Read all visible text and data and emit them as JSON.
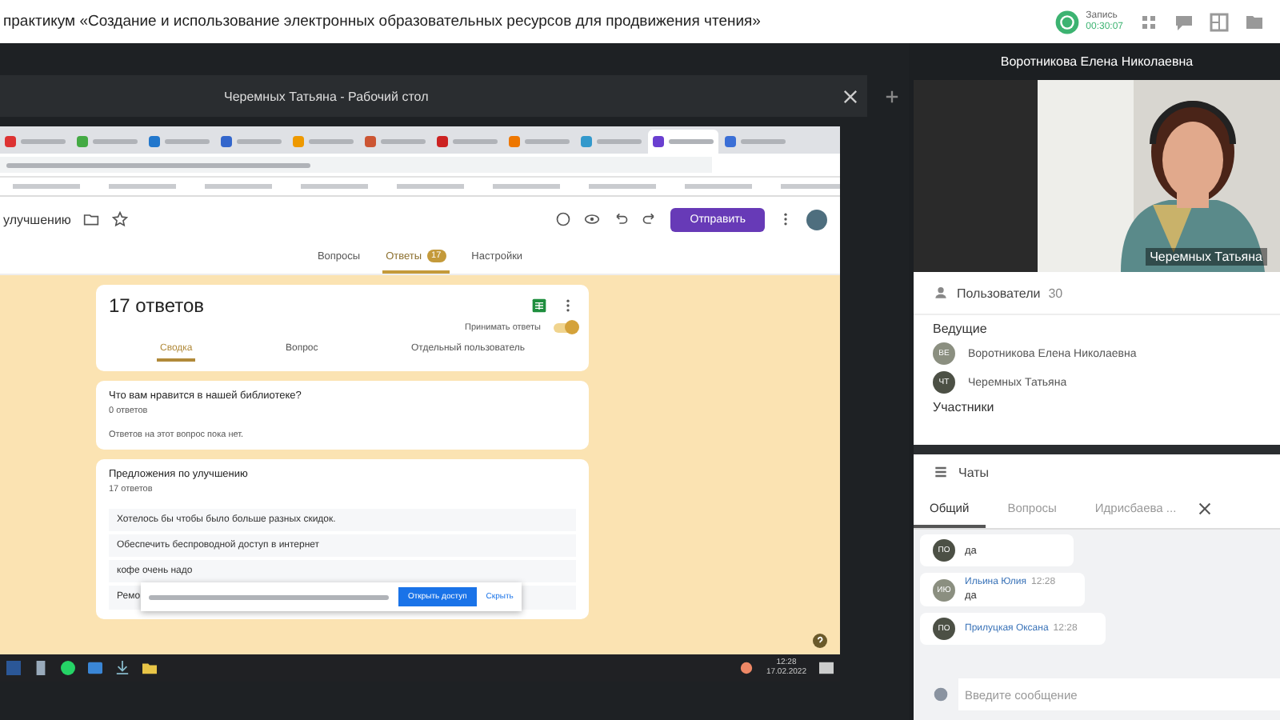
{
  "top_bar": {
    "title": "практикум «Создание и использование электронных образовательных ресурсов для продвижения чтения»",
    "record_label": "Запись",
    "record_time": "00:30:07",
    "recording": true
  },
  "shared_screen": {
    "window_title": "Черемных Татьяна - Рабочий стол",
    "browser": {
      "tabs": [
        {
          "selected": false
        },
        {
          "selected": false
        },
        {
          "selected": false
        },
        {
          "selected": false
        },
        {
          "selected": false
        },
        {
          "selected": false
        },
        {
          "selected": false
        },
        {
          "selected": false
        },
        {
          "selected": false
        },
        {
          "selected": true
        },
        {
          "selected": false
        }
      ],
      "form_title": "улучшению",
      "send_button": "Отправить",
      "form_tabs": [
        {
          "label": "Вопросы",
          "selected": false
        },
        {
          "label": "Ответы",
          "selected": true,
          "badge": "17"
        },
        {
          "label": "Настройки",
          "selected": false
        }
      ],
      "summary": {
        "title": "17 ответов",
        "accepting_label": "Принимать ответы",
        "accepting": true,
        "tabs": [
          {
            "label": "Сводка",
            "selected": true
          },
          {
            "label": "Вопрос",
            "selected": false
          },
          {
            "label": "Отдельный пользователь",
            "selected": false
          }
        ]
      },
      "questions": [
        {
          "title": "Что вам нравится в нашей библиотеке?",
          "count": "0 ответов",
          "empty_text": "Ответов на этот вопрос пока нет."
        },
        {
          "title": "Предложения по улучшению",
          "count": "17 ответов",
          "answers": [
            "Хотелось бы чтобы было больше разных скидок.",
            "Обеспечить беспроводной доступ в интернет",
            "кофе очень надо",
            "Ремо"
          ]
        }
      ],
      "snackbar": {
        "button": "Открыть доступ",
        "dismiss": "Скрыть"
      }
    },
    "taskbar": {
      "time": "12:28",
      "date": "17.02.2022"
    }
  },
  "video": {
    "header_name": "Воротникова Елена Николаевна",
    "overlay_name": "Черемных Татьяна"
  },
  "users": {
    "title": "Пользователи",
    "count": "30",
    "groups": [
      {
        "title": "Ведущие",
        "members": [
          {
            "initials": "ВЕ",
            "name": "Воротникова Елена Николаевна"
          },
          {
            "initials": "ЧТ",
            "name": "Черемных Татьяна"
          }
        ]
      },
      {
        "title": "Участники"
      }
    ]
  },
  "chat": {
    "title": "Чаты",
    "tabs": [
      {
        "label": "Общий",
        "selected": true,
        "closable": false
      },
      {
        "label": "Вопросы",
        "selected": false,
        "closable": false
      },
      {
        "label": "Идрисбаева ...",
        "selected": false,
        "closable": true
      }
    ],
    "messages": [
      {
        "initials": "ПО",
        "text": "да"
      },
      {
        "initials": "ИЮ",
        "author": "Ильина Юлия",
        "time": "12:28",
        "text": "да"
      },
      {
        "initials": "ПО",
        "author": "Прилуцкая Оксана",
        "time": "12:28"
      }
    ],
    "input_placeholder": "Введите сообщение"
  }
}
